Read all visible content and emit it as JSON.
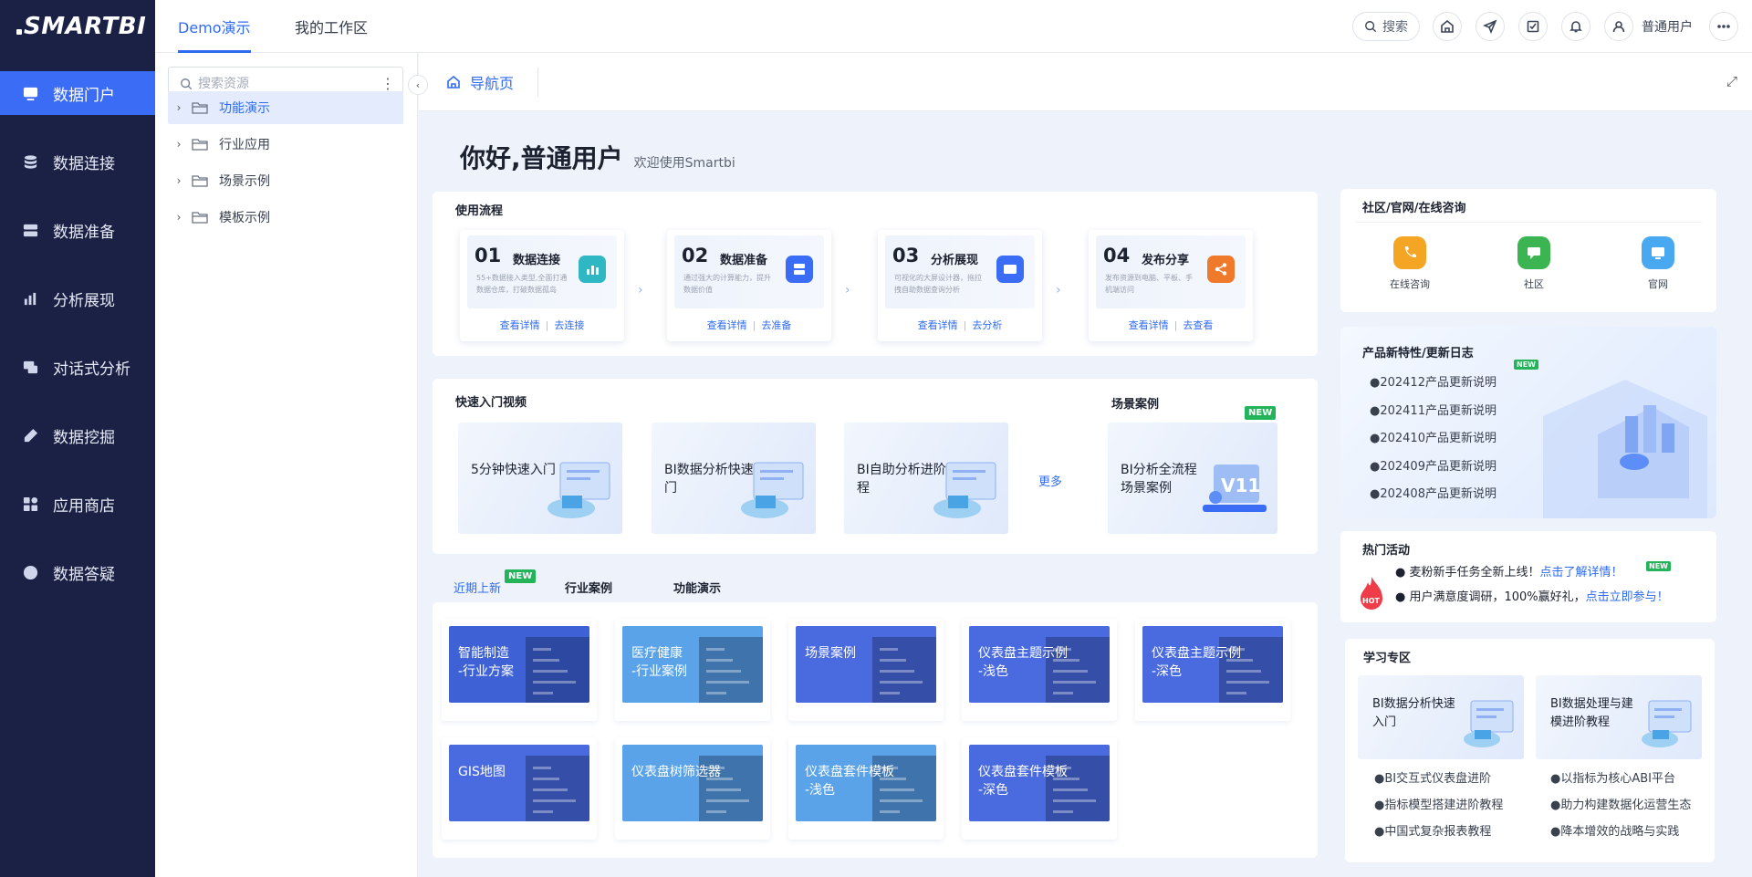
{
  "app": {
    "logo_text": "SMARTBI"
  },
  "leftnav": {
    "items": [
      {
        "label": "数据门户",
        "icon": "portal-icon",
        "active": true
      },
      {
        "label": "数据连接",
        "icon": "database-icon"
      },
      {
        "label": "数据准备",
        "icon": "server-icon"
      },
      {
        "label": "分析展现",
        "icon": "bar-chart-icon"
      },
      {
        "label": "对话式分析",
        "icon": "chat-icon"
      },
      {
        "label": "数据挖掘",
        "icon": "pickaxe-icon"
      },
      {
        "label": "应用商店",
        "icon": "apps-icon"
      },
      {
        "label": "数据答疑",
        "icon": "help-icon"
      }
    ]
  },
  "topbar": {
    "tabs": [
      {
        "label": "Demo演示",
        "active": true
      },
      {
        "label": "我的工作区"
      }
    ],
    "search_label": "搜索",
    "user_name": "普通用户",
    "icons": [
      "home-icon",
      "send-icon",
      "task-icon",
      "bell-icon",
      "user-icon",
      "more-icon"
    ]
  },
  "tree": {
    "search_placeholder": "搜索资源",
    "items": [
      {
        "label": "功能演示",
        "active": true
      },
      {
        "label": "行业应用"
      },
      {
        "label": "场景示例"
      },
      {
        "label": "模板示例"
      }
    ]
  },
  "breadcrumb": {
    "tab_label": "导航页"
  },
  "greeting": {
    "title": "你好,普通用户",
    "subtitle": "欢迎使用Smartbi"
  },
  "flow": {
    "title": "使用流程",
    "steps": [
      {
        "num": "01",
        "name": "数据连接",
        "desc": "55+数据接入类型,全面打通数据仓库，打破数据孤岛",
        "link1": "查看详情",
        "link2": "去连接",
        "color": "#2fb8c4"
      },
      {
        "num": "02",
        "name": "数据准备",
        "desc": "通过强大的计算能力，提升数据价值",
        "link1": "查看详情",
        "link2": "去准备",
        "color": "#3b6cf5"
      },
      {
        "num": "03",
        "name": "分析展现",
        "desc": "可视化的大屏设计器，拖拉拽自助数据查询分析",
        "link1": "查看详情",
        "link2": "去分析",
        "color": "#3b6cf5"
      },
      {
        "num": "04",
        "name": "发布分享",
        "desc": "发布资源到电脑、平板、手机端访问",
        "link1": "查看详情",
        "link2": "去查看",
        "color": "#f07a2c"
      }
    ]
  },
  "videos": {
    "title": "快速入门视频",
    "items": [
      "5分钟快速入门",
      "BI数据分析快速入门",
      "BI自助分析进阶教程"
    ],
    "more": "更多"
  },
  "scenes": {
    "title": "场景案例",
    "badge": "NEW",
    "card_text": "BI分析全流程场景案例"
  },
  "case_tabs": {
    "tabs": [
      "近期上新",
      "行业案例",
      "功能演示"
    ],
    "badge": "NEW"
  },
  "cases": [
    {
      "label1": "智能制造",
      "label2": "-行业方案",
      "color": "#3e62d6"
    },
    {
      "label1": "医疗健康",
      "label2": "-行业案例",
      "color": "#5aa3e8"
    },
    {
      "label1": "场景案例",
      "label2": "",
      "color": "#4a6ae0"
    },
    {
      "label1": "仪表盘主题示例",
      "label2": "-浅色",
      "color": "#4a6ae0"
    },
    {
      "label1": "仪表盘主题示例",
      "label2": "-深色",
      "color": "#4a6ae0"
    },
    {
      "label1": "GIS地图",
      "label2": "",
      "color": "#4a6ae0"
    },
    {
      "label1": "仪表盘树筛选器",
      "label2": "",
      "color": "#5aa3e8"
    },
    {
      "label1": "仪表盘套件模板",
      "label2": "-浅色",
      "color": "#5aa3e8"
    },
    {
      "label1": "仪表盘套件模板",
      "label2": "-深色",
      "color": "#4a6ae0"
    }
  ],
  "community": {
    "title": "社区/官网/在线咨询",
    "items": [
      {
        "label": "在线咨询",
        "color": "#f5a524",
        "icon": "phone-icon"
      },
      {
        "label": "社区",
        "color": "#3cb451",
        "icon": "message-icon"
      },
      {
        "label": "官网",
        "color": "#49a9f0",
        "icon": "website-icon"
      }
    ]
  },
  "updates": {
    "title": "产品新特性/更新日志",
    "badge": "NEW",
    "items": [
      "●202412产品更新说明",
      "●202411产品更新说明",
      "●202410产品更新说明",
      "●202409产品更新说明",
      "●202408产品更新说明"
    ]
  },
  "activities": {
    "title": "热门活动",
    "badge": "NEW",
    "hot_label": "HOT",
    "items": [
      {
        "text": "麦粉新手任务全新上线！",
        "link": "点击了解详情！"
      },
      {
        "text": "用户满意度调研，100%赢好礼，",
        "link": "点击立即参与！"
      }
    ]
  },
  "learning": {
    "title": "学习专区",
    "thumbs": [
      "BI数据分析快速入门",
      "BI数据处理与建模进阶教程"
    ],
    "left_list": [
      "●BI交互式仪表盘进阶",
      "●指标模型搭建进阶教程",
      "●中国式复杂报表教程"
    ],
    "right_list": [
      "●以指标为核心ABI平台",
      "●助力构建数据化运营生态",
      "●降本增效的战略与实践"
    ]
  }
}
